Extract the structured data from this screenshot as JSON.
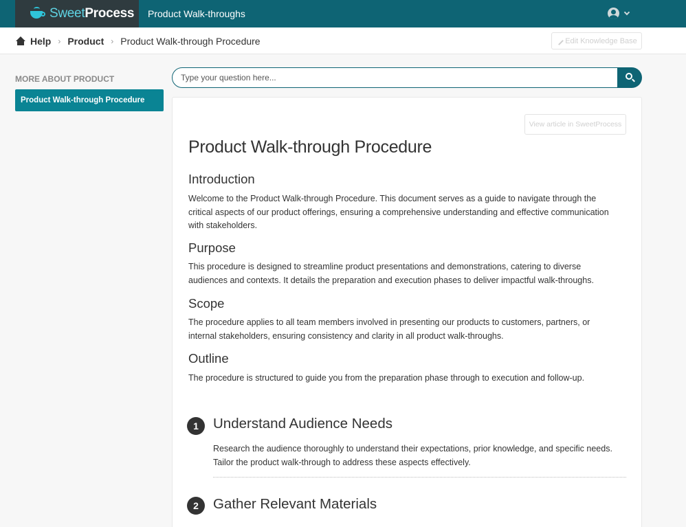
{
  "header": {
    "logo_light": "Sweet",
    "logo_bold": "Process",
    "title": "Product Walk-throughs"
  },
  "breadcrumb": {
    "items": [
      "Help",
      "Product"
    ],
    "current": "Product Walk-through Procedure",
    "edit_label": "Edit Knowledge Base"
  },
  "sidebar": {
    "title": "MORE ABOUT PRODUCT",
    "items": [
      {
        "label": "Product Walk-through Procedure",
        "active": true
      }
    ]
  },
  "search": {
    "placeholder": "Type your question here..."
  },
  "article": {
    "view_label": "View article in SweetProcess",
    "title": "Product Walk-through Procedure",
    "sections": [
      {
        "heading": "Introduction",
        "lines": [
          "Welcome to the Product Walk-through Procedure. This document serves as a guide to navigate through the",
          "critical aspects of our product offerings, ensuring a comprehensive understanding and effective communication",
          "with stakeholders."
        ]
      },
      {
        "heading": "Purpose",
        "lines": [
          "This procedure is designed to streamline product presentations and demonstrations, catering to diverse",
          "audiences and contexts. It details the preparation and execution phases to deliver impactful walk-throughs."
        ]
      },
      {
        "heading": "Scope",
        "lines": [
          "The procedure applies to all team members involved in presenting our products to customers, partners, or",
          "internal stakeholders, ensuring consistency and clarity in all product walk-throughs."
        ]
      },
      {
        "heading": "Outline",
        "lines": [
          "The procedure is structured to guide you from the preparation phase through to execution and follow-up."
        ]
      }
    ],
    "steps": [
      {
        "number": "1",
        "title": "Understand Audience Needs",
        "lines": [
          "Research the audience thoroughly to understand their expectations, prior knowledge, and specific needs.",
          "Tailor the product walk-through to address these aspects effectively."
        ]
      },
      {
        "number": "2",
        "title": "Gather Relevant Materials"
      }
    ]
  },
  "colors": {
    "header_bg": "#0e6474",
    "logo_bg": "#2f3b3f",
    "accent": "#0a8494"
  }
}
